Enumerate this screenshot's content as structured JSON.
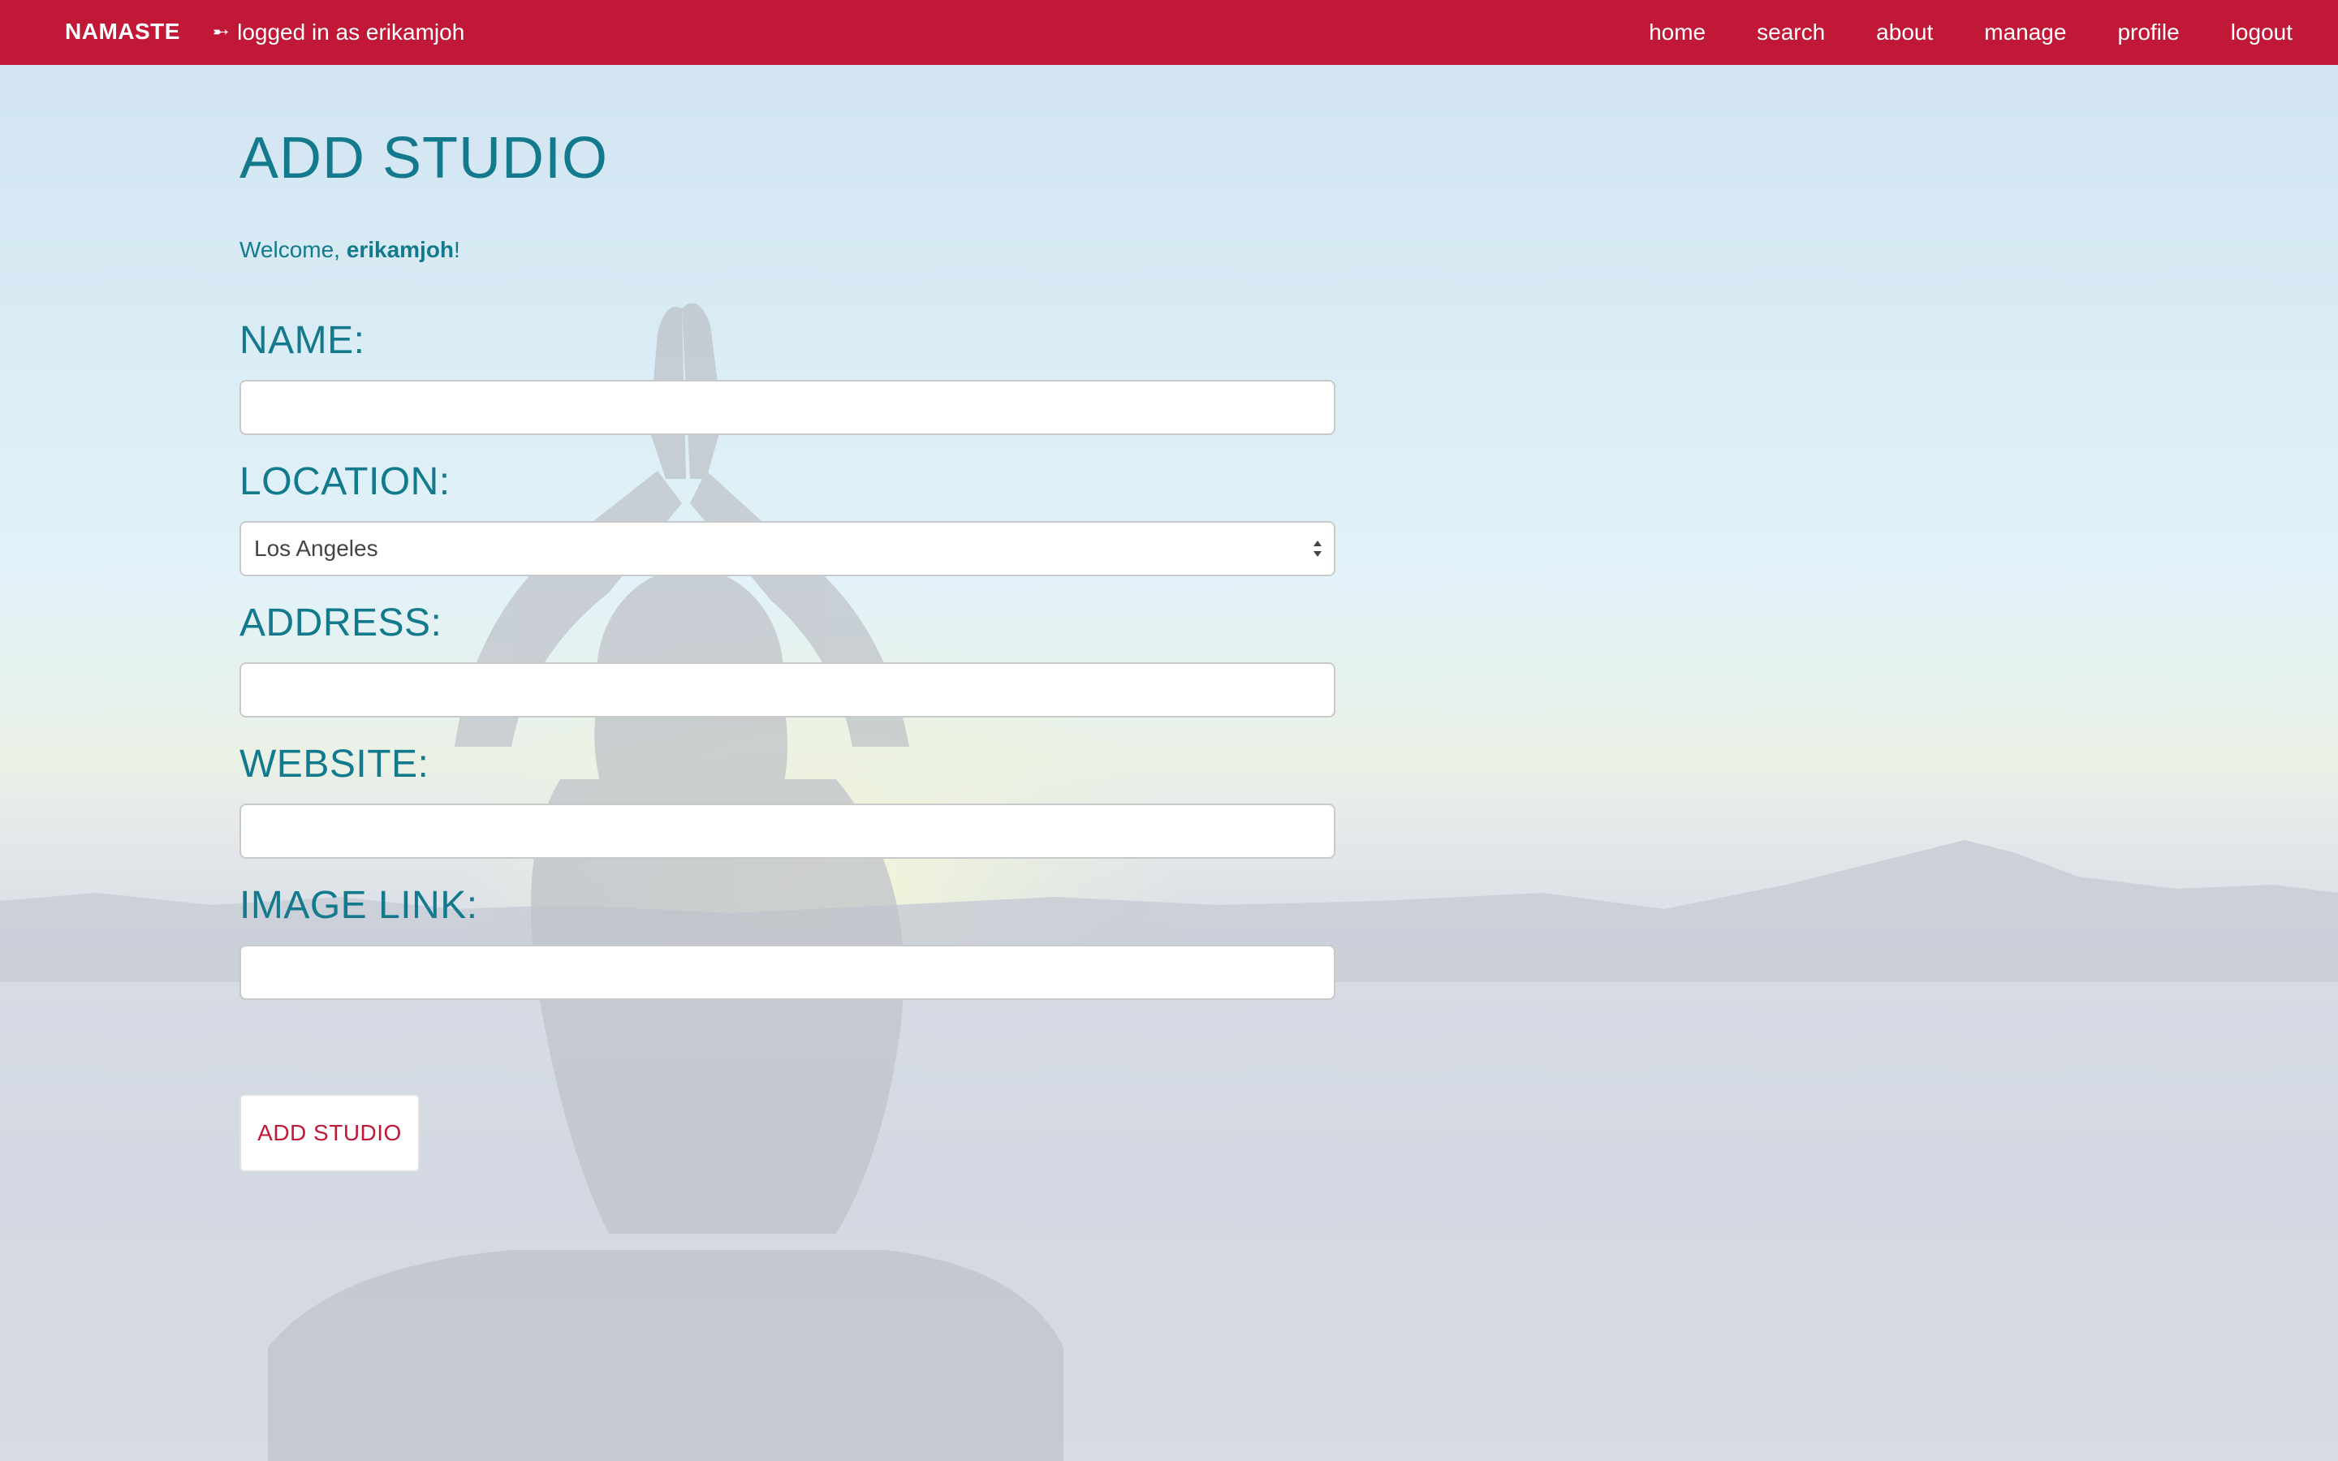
{
  "navbar": {
    "brand": "NAMASTE",
    "login_icon": "sign-in-icon",
    "login_status": "logged in as erikamjoh",
    "links": [
      "home",
      "search",
      "about",
      "manage",
      "profile",
      "logout"
    ],
    "background_color": "#c11837"
  },
  "page": {
    "title": "ADD STUDIO",
    "welcome_prefix": "Welcome, ",
    "welcome_user": "erikamjoh",
    "welcome_suffix": "!",
    "accent_color": "#13798c"
  },
  "form": {
    "name_label": "NAME:",
    "name_value": "",
    "location_label": "LOCATION:",
    "location_value": "Los Angeles",
    "address_label": "ADDRESS:",
    "address_value": "",
    "website_label": "WEBSITE:",
    "website_value": "",
    "image_link_label": "IMAGE LINK:",
    "image_link_value": "",
    "submit_label": "ADD STUDIO",
    "submit_color": "#c11837"
  }
}
